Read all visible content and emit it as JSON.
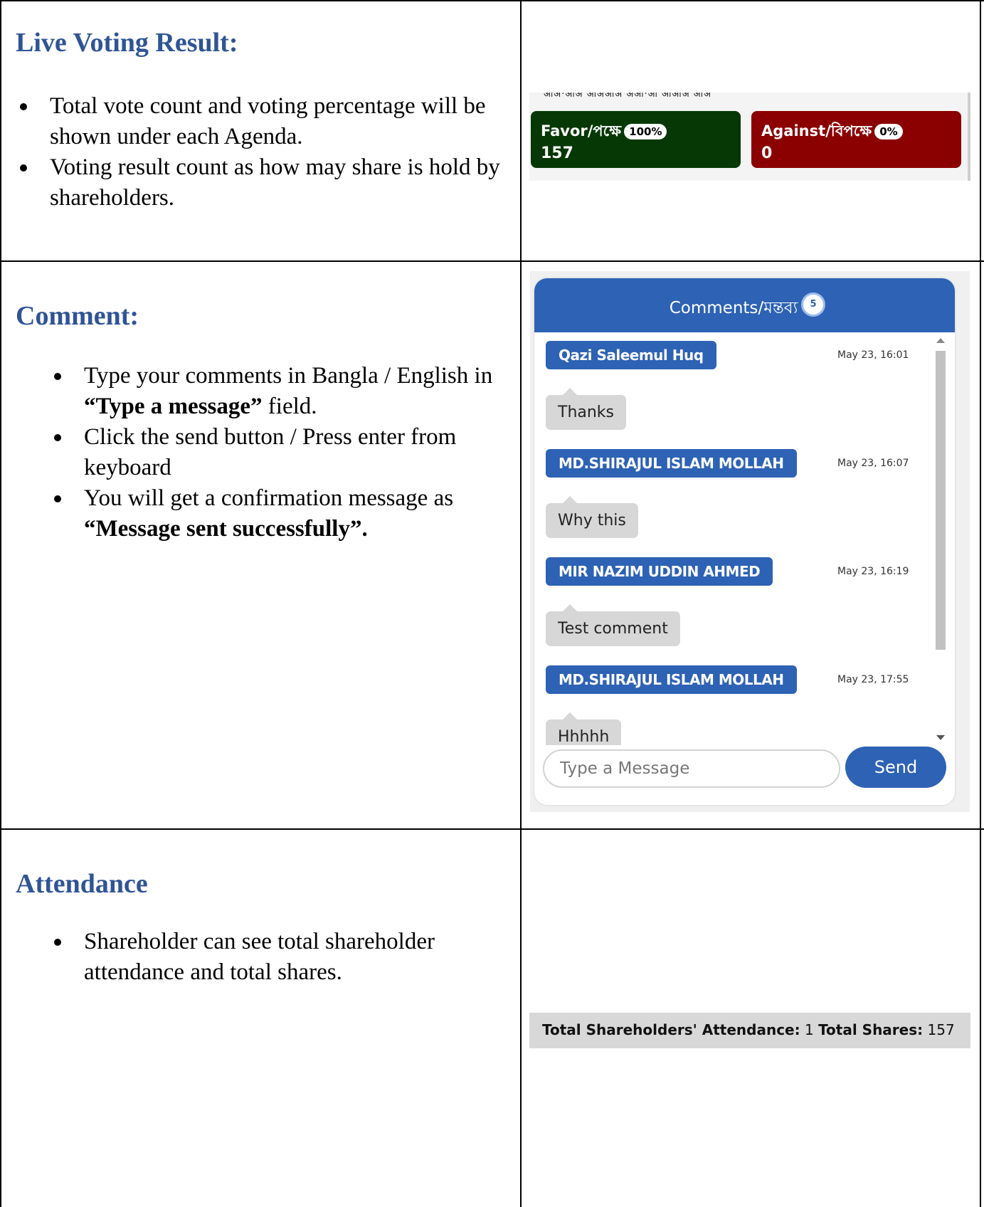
{
  "sections": {
    "voting": {
      "heading": "Live Voting Result:",
      "bullets": [
        "Total vote count and voting percentage will be shown under each Agenda.",
        "Voting result count as how may share is hold by shareholders."
      ]
    },
    "comment": {
      "heading": "Comment:",
      "bullet1": "Type your comments in Bangla / English in ",
      "bullet1_bold": "“Type a message”",
      "bullet1_end": " field.",
      "bullet2": "Click the send button / Press enter from keyboard",
      "bullet3": "You will get a confirmation message as ",
      "bullet3_bold": "“Message sent successfully”."
    },
    "attendance": {
      "heading": "Attendance",
      "bullets": [
        "Shareholder can see total shareholder attendance and total shares."
      ]
    }
  },
  "voting_panel": {
    "favor_label": "Favor/পক্ষে",
    "favor_percent": "100%",
    "favor_count": "157",
    "against_label": "Against/বিপক্ষে",
    "against_percent": "0%",
    "against_count": "0",
    "favor_color": "#063806",
    "against_color": "#8b0000"
  },
  "comments_panel": {
    "title": "Comments/মন্তব্য",
    "count": "5",
    "messages": [
      {
        "author": "Qazi Saleemul Huq",
        "time": "May 23, 16:01",
        "text": "Thanks"
      },
      {
        "author": "MD.SHIRAJUL ISLAM MOLLAH",
        "time": "May 23, 16:07",
        "text": "Why this"
      },
      {
        "author": "MIR NAZIM UDDIN AHMED",
        "time": "May 23, 16:19",
        "text": "Test comment"
      },
      {
        "author": "MD.SHIRAJUL ISLAM MOLLAH",
        "time": "May 23, 17:55",
        "text": "Hhhhh"
      }
    ],
    "input_placeholder": "Type a Message",
    "send_label": "Send",
    "accent_color": "#2d62b4"
  },
  "attendance_panel": {
    "attendance_label": "Total Shareholders' Attendance:",
    "attendance_value": "1",
    "shares_label": "Total Shares:",
    "shares_value": "157"
  },
  "colors": {
    "heading": "#2f5496"
  }
}
